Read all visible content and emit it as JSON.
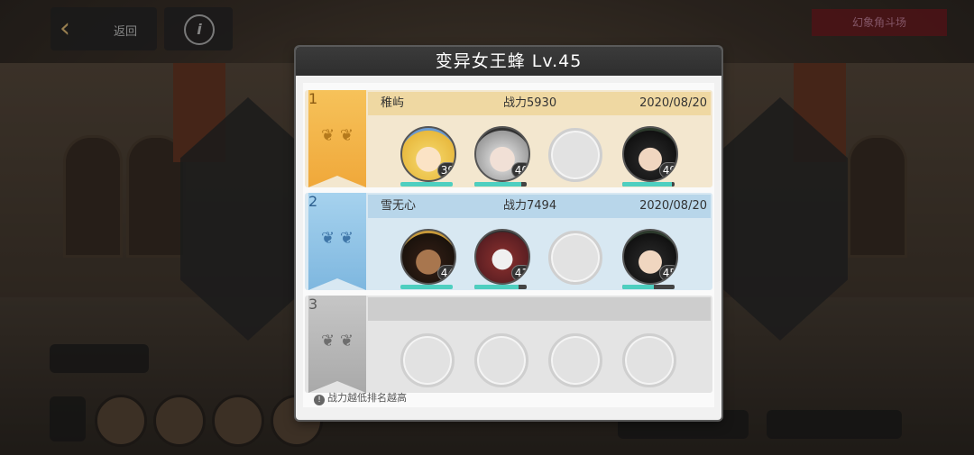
{
  "header": {
    "back_label": "返回",
    "info_icon": "info-icon",
    "back_icon": "chevron-left-icon",
    "mode_badge": "幻象角斗场"
  },
  "dialog": {
    "title": "变异女王蜂  Lv.45",
    "footnote": "战力越低排名越高",
    "footnote_icon": "exclamation-icon"
  },
  "ranks": [
    {
      "rank": "1",
      "name": "稚屿",
      "power": "战力5930",
      "date": "2020/08/20",
      "color": "#f2b24a",
      "heroes": [
        {
          "level": "39",
          "hp": 1.0
        },
        {
          "level": "40",
          "hp": 0.9
        },
        null,
        {
          "level": "49",
          "hp": 0.95
        }
      ]
    },
    {
      "rank": "2",
      "name": "雪无心",
      "power": "战力7494",
      "date": "2020/08/20",
      "color": "#8ec2e6",
      "heroes": [
        {
          "level": "44",
          "hp": 1.0
        },
        {
          "level": "41",
          "hp": 0.85
        },
        null,
        {
          "level": "45",
          "hp": 0.6
        }
      ]
    },
    {
      "rank": "3",
      "name": "",
      "power": "",
      "date": "",
      "color": "#b8b8b8",
      "heroes": [
        null,
        null,
        null,
        null
      ]
    }
  ]
}
